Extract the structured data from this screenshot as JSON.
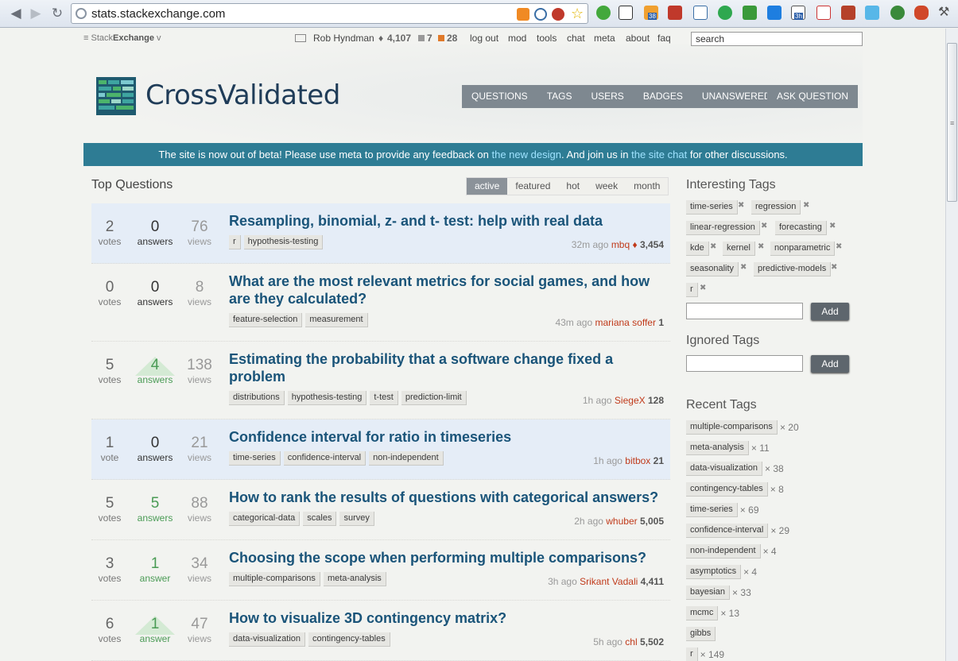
{
  "browser": {
    "url": "stats.stackexchange.com",
    "ext_badge_38": "38",
    "ext_badge_3h": "3h"
  },
  "topbar": {
    "brand_light": "Stack",
    "brand_bold": "Exchange",
    "brand_chevron": "v",
    "user": "Rob Hyndman",
    "rep_diamond": "♦",
    "rep": "4,107",
    "badge_silver": "7",
    "badge_bronze": "28",
    "links": [
      "log out",
      "mod",
      "tools",
      "chat",
      "meta",
      "about",
      "faq"
    ],
    "search_placeholder": "search"
  },
  "header": {
    "site_name": "CrossValidated",
    "nav": [
      "QUESTIONS",
      "TAGS",
      "USERS",
      "BADGES",
      "UNANSWERED"
    ],
    "ask": "ASK QUESTION"
  },
  "banner": {
    "pre": "The site is now out of beta! Please use meta to provide any feedback on ",
    "link1": "the new design",
    "mid": ". And join us in ",
    "link2": "the site chat",
    "post": " for other discussions."
  },
  "main": {
    "title": "Top Questions",
    "tabs": [
      "active",
      "featured",
      "hot",
      "week",
      "month"
    ],
    "active_tab": "active"
  },
  "questions": [
    {
      "votes": "2",
      "votes_label": "votes",
      "answers": "0",
      "answers_label": "answers",
      "views": "76",
      "views_label": "views",
      "title": "Resampling, binomial, z- and t- test: help with real data",
      "tags": [
        "r",
        "hypothesis-testing"
      ],
      "time": "32m ago",
      "user": "mbq",
      "diamond": "♦",
      "rep": "3,454"
    },
    {
      "votes": "0",
      "votes_label": "votes",
      "answers": "0",
      "answers_label": "answers",
      "views": "8",
      "views_label": "views",
      "title": "What are the most relevant metrics for social games, and how are they calculated?",
      "tags": [
        "feature-selection",
        "measurement"
      ],
      "time": "43m ago",
      "user": "mariana soffer",
      "diamond": "",
      "rep": "1"
    },
    {
      "votes": "5",
      "votes_label": "votes",
      "answers": "4",
      "answers_label": "answers",
      "views": "138",
      "views_label": "views",
      "title": "Estimating the probability that a software change fixed a problem",
      "tags": [
        "distributions",
        "hypothesis-testing",
        "t-test",
        "prediction-limit"
      ],
      "time": "1h ago",
      "user": "SiegeX",
      "diamond": "",
      "rep": "128"
    },
    {
      "votes": "1",
      "votes_label": "vote",
      "answers": "0",
      "answers_label": "answers",
      "views": "21",
      "views_label": "views",
      "title": "Confidence interval for ratio in timeseries",
      "tags": [
        "time-series",
        "confidence-interval",
        "non-independent"
      ],
      "time": "1h ago",
      "user": "bitbox",
      "diamond": "",
      "rep": "21"
    },
    {
      "votes": "5",
      "votes_label": "votes",
      "answers": "5",
      "answers_label": "answers",
      "views": "88",
      "views_label": "views",
      "title": "How to rank the results of questions with categorical answers?",
      "tags": [
        "categorical-data",
        "scales",
        "survey"
      ],
      "time": "2h ago",
      "user": "whuber",
      "diamond": "",
      "rep": "5,005"
    },
    {
      "votes": "3",
      "votes_label": "votes",
      "answers": "1",
      "answers_label": "answer",
      "views": "34",
      "views_label": "views",
      "title": "Choosing the scope when performing multiple comparisons?",
      "tags": [
        "multiple-comparisons",
        "meta-analysis"
      ],
      "time": "3h ago",
      "user": "Srikant Vadali",
      "diamond": "",
      "rep": "4,411"
    },
    {
      "votes": "6",
      "votes_label": "votes",
      "answers": "1",
      "answers_label": "answer",
      "views": "47",
      "views_label": "views",
      "title": "How to visualize 3D contingency matrix?",
      "tags": [
        "data-visualization",
        "contingency-tables"
      ],
      "time": "5h ago",
      "user": "chl",
      "diamond": "",
      "rep": "5,502"
    }
  ],
  "sidebar": {
    "interesting_title": "Interesting Tags",
    "interesting_tags": [
      "time-series",
      "regression",
      "linear-regression",
      "forecasting",
      "kde",
      "kernel",
      "nonparametric",
      "seasonality",
      "predictive-models",
      "r"
    ],
    "remove_glyph": "✖",
    "add_label": "Add",
    "ignored_title": "Ignored Tags",
    "recent_title": "Recent Tags",
    "recent_tags": [
      {
        "tag": "multiple-comparisons",
        "count": "× 20"
      },
      {
        "tag": "meta-analysis",
        "count": "× 11"
      },
      {
        "tag": "data-visualization",
        "count": "× 38"
      },
      {
        "tag": "contingency-tables",
        "count": "× 8"
      },
      {
        "tag": "time-series",
        "count": "× 69"
      },
      {
        "tag": "confidence-interval",
        "count": "× 29"
      },
      {
        "tag": "non-independent",
        "count": "× 4"
      },
      {
        "tag": "asymptotics",
        "count": "× 4"
      },
      {
        "tag": "bayesian",
        "count": "× 33"
      },
      {
        "tag": "mcmc",
        "count": "× 13"
      },
      {
        "tag": "gibbs",
        "count": ""
      },
      {
        "tag": "r",
        "count": "× 149"
      }
    ]
  },
  "colors": {
    "banner": "#2e7c94",
    "nav": "#7e8890",
    "title_link": "#1a5479",
    "user_link": "#c03a1a",
    "highlight_row": "#e5edf7"
  }
}
